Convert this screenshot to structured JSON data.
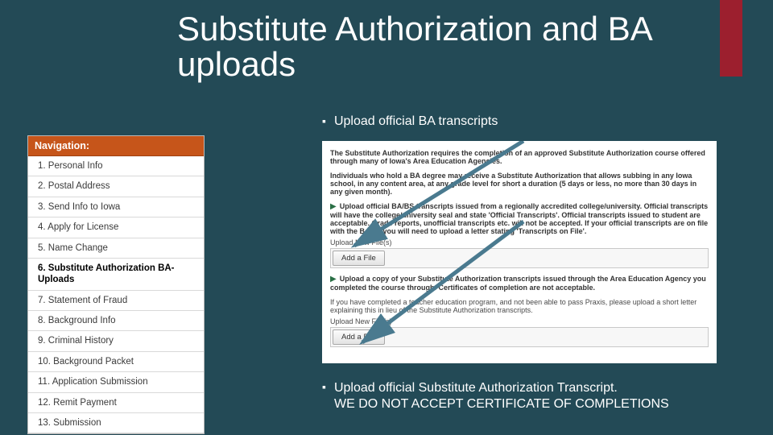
{
  "title": "Substitute Authorization and BA uploads",
  "bullets": {
    "top": "Upload official BA transcripts",
    "bottom_line1": "Upload official Substitute Authorization Transcript.",
    "bottom_line2": "WE DO NOT ACCEPT CERTIFICATE OF COMPLETIONS"
  },
  "nav": {
    "header": "Navigation:",
    "items": [
      "1. Personal Info",
      "2. Postal Address",
      "3. Send Info to Iowa",
      "4. Apply for License",
      "5. Name Change",
      "6. Substitute Authorization BA- Uploads",
      "7. Statement of Fraud",
      "8. Background Info",
      "9. Criminal History",
      "10. Background Packet",
      "11. Application Submission",
      "12. Remit Payment",
      "13. Submission"
    ],
    "active_index": 5
  },
  "panel": {
    "intro1": "The Substitute Authorization requires the completion of an approved Substitute Authorization course offered through many of Iowa's Area Education Agencies.",
    "intro2": "Individuals who hold a BA degree may receive a Substitute Authorization that allows subbing in any Iowa school, in any content area, at any grade level for short a duration (5 days or less, no more than 30 days in any given month).",
    "section1": "Upload official BA/BS transcripts issued from a regionally accredited college/university. Official transcripts will have the college/university seal and state 'Official Transcripts'. Official transcripts issued to student are acceptable. Grade reports, unofficial transcripts etc. will not be accepted.  If your official transcripts are on file with the BoEE, you will need to upload a letter stating 'Transcripts on File'.",
    "upload_label": "Upload New File(s)",
    "add_file": "Add a File",
    "section2": "Upload a copy of your Substitute Authorization transcripts issued through the Area Education Agency you completed the course through. Certificates of completion are not acceptable.",
    "section3": "If you have completed a teacher education program, and not been able to pass Praxis, please upload a short letter explaining this in lieu of the Substitute Authorization transcripts."
  }
}
